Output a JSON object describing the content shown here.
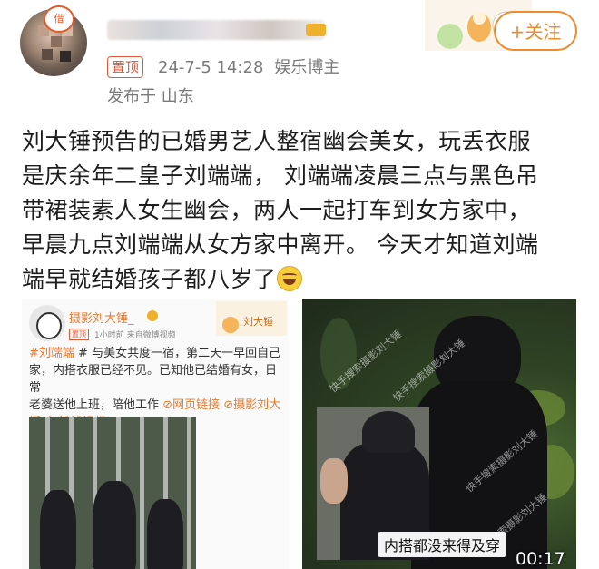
{
  "post": {
    "author_avatar_badge": "借",
    "pinned_label": "置顶",
    "datetime": "24-7-5 14:28",
    "source": "娱乐博主",
    "location": "发布于 山东",
    "follow_label": "+关注",
    "body_lines": [
      "刘大锤预告的已婚男艺人整宿幽会美女，玩丢衣服",
      "是庆余年二皇子刘端端， 刘端端凌晨三点与黑色吊",
      "带裙装素人女生幽会，两人一起打车到女方家中，",
      "早晨九点刘端端从女方家中离开。 今天才知道刘端",
      "端早就结婚孩子都八岁了"
    ],
    "emoji_icon": "laughing-tears-emoji"
  },
  "embedded": {
    "author_name": "摄影刘大锤_",
    "pinned_label": "置顶",
    "time": "1小时前 来自微博视频",
    "deco_label": "刘大锤",
    "text_lines": [
      {
        "hl": "#刘端端",
        "rest": " # 与美女共度一宿，第二天一早回自己"
      },
      {
        "hl": "",
        "rest": "家，内搭衣服已经不见。已知他已结婚有女，日常"
      },
      {
        "hl": "",
        "rest": "老婆送他上班，陪他工作"
      },
      {
        "hl": "网页链接 ",
        "rest": ""
      },
      {
        "hl": "摄影刘大锤_的微博视频",
        "rest": ""
      }
    ],
    "link_icon": "link-icon"
  },
  "video": {
    "watermark": "快手搜索摄影刘大锤",
    "subtitle": "内搭都没来得及穿",
    "timecode": "00:17"
  }
}
